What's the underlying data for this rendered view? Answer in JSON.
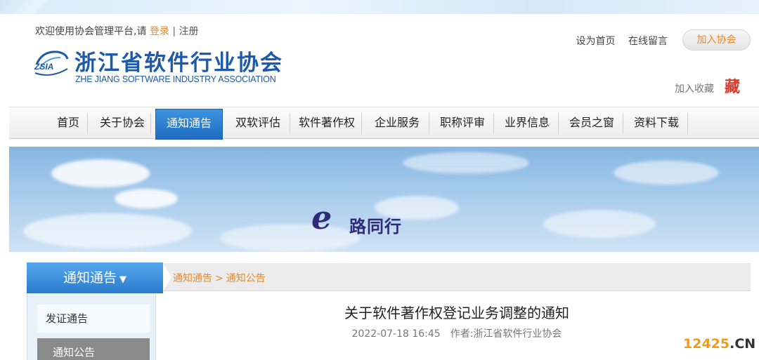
{
  "header": {
    "welcome_prefix": "欢迎使用协会管理平台,请",
    "login": "登录",
    "separator": "|",
    "register": "注册",
    "logo_cn": "浙江省软件行业协会",
    "logo_en": "ZHE JIANG SOFTWARE INDUSTRY ASSOCIATION",
    "logo_badge": "ZSIA",
    "set_home": "设为首页",
    "leave_message": "在线留言",
    "join": "加入协会",
    "favorite": "加入收藏",
    "favorite_icon_glyph": "藏"
  },
  "nav": {
    "items": [
      {
        "label": "首页"
      },
      {
        "label": "关于协会"
      },
      {
        "label": "通知通告",
        "active": true
      },
      {
        "label": "双软评估"
      },
      {
        "label": "软件著作权"
      },
      {
        "label": "企业服务"
      },
      {
        "label": "职称评审"
      },
      {
        "label": "业界信息"
      },
      {
        "label": "会员之窗"
      },
      {
        "label": "资料下载"
      }
    ]
  },
  "banner": {
    "letter": "e",
    "slogan": "路同行"
  },
  "sidebar": {
    "title": "通知通告",
    "arrow": "▼",
    "items": [
      {
        "label": "发证通告"
      },
      {
        "label": "通知公告",
        "active": true
      }
    ]
  },
  "breadcrumb": {
    "level1": "通知通告",
    "gt": ">",
    "level2": "通知公告"
  },
  "article": {
    "title": "关于软件著作权登记业务调整的通知",
    "date": "2022-07-18 16:45",
    "author_label": "作者:",
    "author": "浙江省软件行业协会"
  },
  "watermark": {
    "number": "12425",
    "domain": ".CN"
  },
  "colors": {
    "accent_blue": "#1e5aa8",
    "nav_active": "#2a7ccd",
    "link_orange": "#e8892a"
  }
}
